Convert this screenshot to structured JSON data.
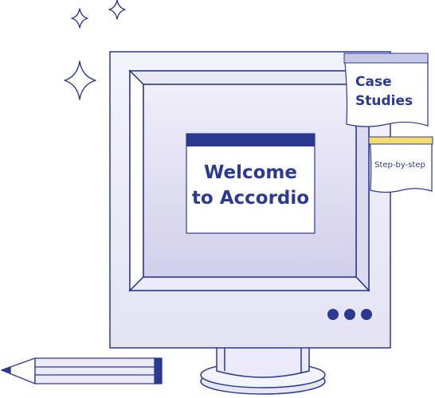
{
  "window": {
    "title_line1": "Welcome",
    "title_line2": "to Accordio"
  },
  "notes": {
    "case_studies_line1": "Case",
    "case_studies_line2": "Studies",
    "step_by_step": "Step-by-step"
  },
  "icons": [
    "sparkle-icon",
    "pencil-icon",
    "dots-icon"
  ],
  "colors": {
    "stroke": "#2b3990",
    "accent_blue": "#2b3990",
    "note_lavender": "#c9c7e6",
    "note_yellow": "#f5dc6a",
    "screen_top": "#eceaf8",
    "screen_bottom": "#d3d0ec"
  }
}
